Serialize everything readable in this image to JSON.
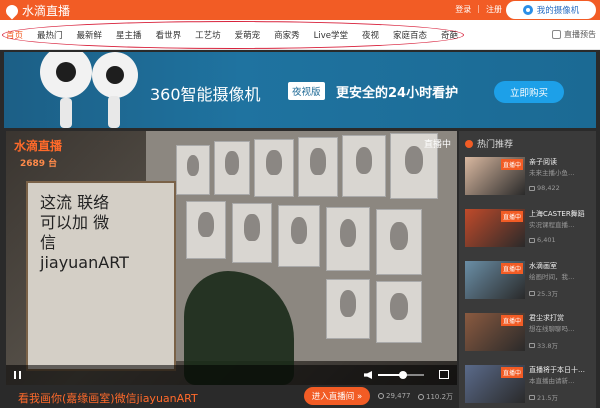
{
  "header": {
    "logo_text": "水滴直播",
    "login": "登录",
    "separator": "|",
    "register": "注册",
    "my_camera": "我的摄像机"
  },
  "nav": {
    "items": [
      "首页",
      "最热门",
      "最新鲜",
      "星主播",
      "看世界",
      "工艺坊",
      "爱萌宠",
      "商家秀",
      "Live学堂",
      "夜视",
      "家庭百态",
      "奇葩"
    ],
    "preview": "直播预告"
  },
  "banner": {
    "title": "360智能摄像机",
    "badge": "夜视版",
    "slogan": "更安全的24小时看护",
    "buy": "立即购买"
  },
  "player": {
    "logo": "水滴直播",
    "viewers": "2689 台",
    "live": "直播中",
    "easel_text": "这流 联络 可以加 微信 jiayuanART",
    "volume": 0.55
  },
  "info": {
    "title": "看我画你(嘉缘画室)微信jiayuanART",
    "enter": "进入直播间 »",
    "views": "29,477",
    "likes": "110.2万"
  },
  "sidebar": {
    "heading": "热门推荐",
    "items": [
      {
        "tag": "直播中",
        "title": "亲子阅读",
        "sub": "未来主播小鱼…",
        "count": "98,422",
        "color": "#d9b8a0"
      },
      {
        "tag": "直播中",
        "title": "上海CASTER舞蹈",
        "sub": "实况课程直播…",
        "count": "6,401",
        "color": "#c04a2a"
      },
      {
        "tag": "直播中",
        "title": "水滴画室",
        "sub": "绘画时间，我…",
        "count": "25.3万",
        "color": "#6a8ea6"
      },
      {
        "tag": "直播中",
        "title": "君尘求打赏",
        "sub": "想在线聊聊吗…",
        "count": "33.8万",
        "color": "#8a5a40"
      },
      {
        "tag": "直播中",
        "title": "直播将于本日十…",
        "sub": "本直播由请新…",
        "count": "21.5万",
        "color": "#5a6a8a"
      }
    ]
  }
}
